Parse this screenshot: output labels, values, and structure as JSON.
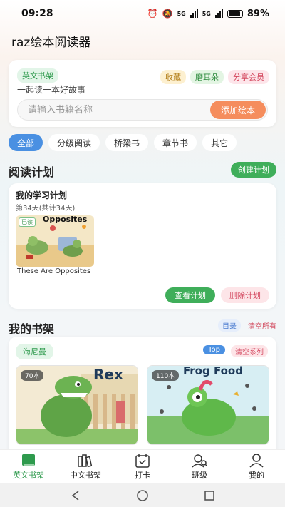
{
  "status": {
    "time": "09:28",
    "network1": "5G",
    "network2": "5G",
    "battery": "89%"
  },
  "app": {
    "title": "raz绘本阅读器"
  },
  "top_card": {
    "badge": "英文书架",
    "tagline": "一起读一本好故事",
    "chips": {
      "favorite": "收藏",
      "ear": "磨耳朵",
      "share": "分享会员"
    },
    "search": {
      "placeholder": "请输入书籍名称",
      "add_button": "添加绘本"
    }
  },
  "categories": [
    "全部",
    "分级阅读",
    "桥梁书",
    "章节书",
    "其它"
  ],
  "reading_plan": {
    "title": "阅读计划",
    "create_button": "创建计划",
    "plan": {
      "name": "我的学习计划",
      "day": "第34天(共计34天)",
      "read_tag": "已读",
      "book_cover_title": "Opposites",
      "book_title": "These Are Opposites",
      "view_button": "查看计划",
      "delete_button": "删除计划"
    }
  },
  "bookshelf": {
    "title": "我的书架",
    "toc_link": "目录",
    "clear_all": "清空所有",
    "series": {
      "name": "海尼曼",
      "top_button": "Top",
      "clear_button": "清空系列",
      "books": [
        {
          "count": "70本",
          "cover_title": "Rex"
        },
        {
          "count": "110本",
          "cover_title": "Frog Food"
        }
      ]
    }
  },
  "tabbar": [
    "英文书架",
    "中文书架",
    "打卡",
    "班级",
    "我的"
  ],
  "colors": {
    "accent_green": "#3fae5a",
    "accent_blue": "#4a90e2",
    "accent_orange": "#f58d5d",
    "accent_red": "#d4485f"
  }
}
